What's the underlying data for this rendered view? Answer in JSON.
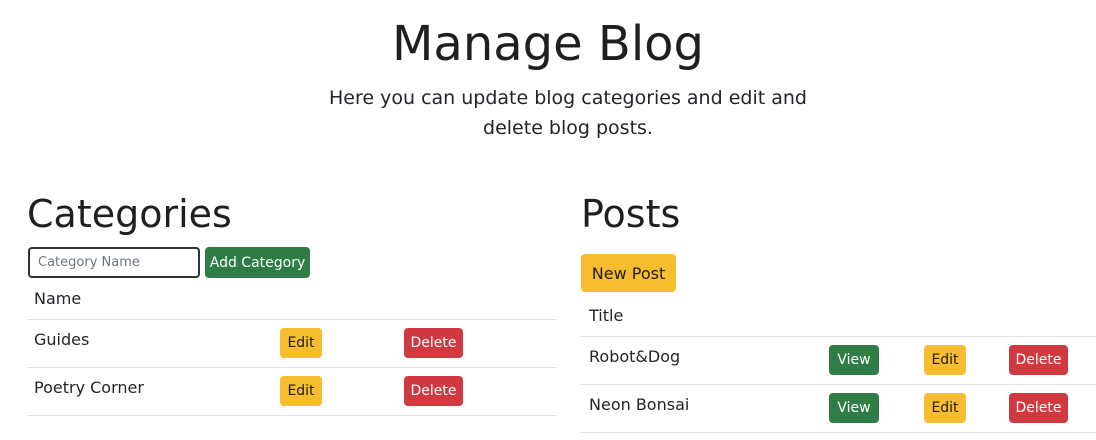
{
  "header": {
    "title": "Manage Blog",
    "subtitle": "Here you can update blog categories and edit and delete blog posts."
  },
  "categories": {
    "title": "Categories",
    "input_placeholder": "Category Name",
    "input_value": "",
    "add_label": "Add Category",
    "column_header": "Name",
    "rows": [
      {
        "name": "Guides",
        "edit": "Edit",
        "delete": "Delete"
      },
      {
        "name": "Poetry Corner",
        "edit": "Edit",
        "delete": "Delete"
      }
    ]
  },
  "posts": {
    "title": "Posts",
    "new_label": "New Post",
    "column_header": "Title",
    "rows": [
      {
        "title": "Robot&Dog",
        "view": "View",
        "edit": "Edit",
        "delete": "Delete"
      },
      {
        "title": "Neon Bonsai",
        "view": "View",
        "edit": "Edit",
        "delete": "Delete"
      }
    ]
  },
  "colors": {
    "success": "#2e7d46",
    "warning": "#f7bd2e",
    "danger": "#d0393f"
  }
}
